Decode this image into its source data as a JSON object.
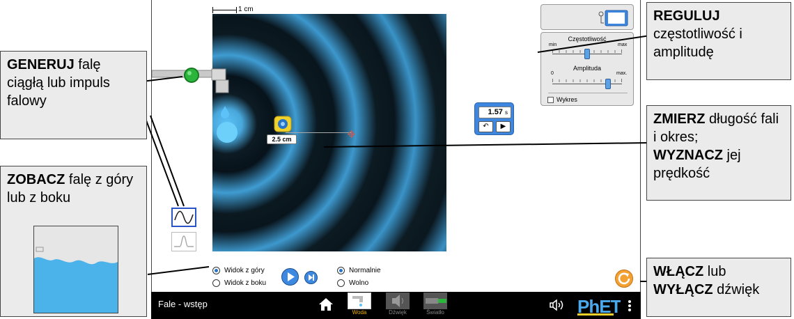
{
  "simulation": {
    "scale_label": "1 cm",
    "timer": {
      "value": "1.57",
      "unit": "s",
      "reset_icon": "reset-arrow-icon",
      "play_icon": "play-icon"
    },
    "tape_measure": {
      "reading": "2.5 cm"
    },
    "controls": {
      "frequency_title": "Częstotliwość",
      "frequency_min": "min",
      "frequency_max": "max",
      "frequency_level": 0.5,
      "amplitude_title": "Amplituda",
      "amplitude_min": "0",
      "amplitude_max": "max.",
      "amplitude_level": 0.8,
      "graph_label": "Wykres",
      "graph_checked": false
    },
    "view_options": [
      {
        "label": "Widok z góry",
        "selected": true
      },
      {
        "label": "Widok z boku",
        "selected": false
      }
    ],
    "speed_options": [
      {
        "label": "Normalnie",
        "selected": true
      },
      {
        "label": "Wolno",
        "selected": false
      }
    ]
  },
  "navbar": {
    "title": "Fale - wstęp",
    "screens": [
      {
        "label": "Woda",
        "selected": true
      },
      {
        "label": "Dźwięk",
        "selected": false
      },
      {
        "label": "Światło",
        "selected": false
      }
    ],
    "brand": "PhET"
  },
  "callouts": {
    "generate": {
      "bold": "GENERUJ",
      "text": " falę ciągłą lub impuls falowy"
    },
    "view": {
      "bold": "ZOBACZ",
      "text": " falę z góry lub z boku"
    },
    "adjust": {
      "bold": "REGULUJ",
      "text": " częstotliwość i amplitudę"
    },
    "measure": {
      "bold1": "ZMIERZ",
      "text1": " długość fali i okres;",
      "bold2": "WYZNACZ",
      "text2": " jej prędkość"
    },
    "sound": {
      "bold1": "WŁĄCZ",
      "text1": " lub",
      "bold2": "WYŁĄCZ",
      "text2": " dźwięk"
    }
  },
  "colors": {
    "accent": "#3d88e0",
    "water": "#4bb2ea",
    "selected_tab": "#f0b400",
    "reset": "#f4a133",
    "callout_bg": "#ebebeb"
  }
}
